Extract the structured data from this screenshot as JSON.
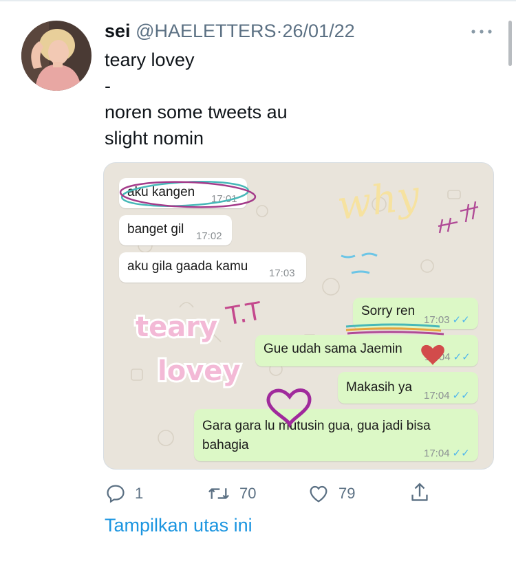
{
  "tweet": {
    "display_name": "sei",
    "handle": "@HAELETTERS",
    "separator": "·",
    "date": "26/01/22",
    "body": "teary lovey\n-\nnoren some tweets au\nslight nomin"
  },
  "chat": {
    "incoming": [
      {
        "text": "aku kangen",
        "time": "17:01"
      },
      {
        "text": "banget gil",
        "time": "17:02"
      },
      {
        "text": "aku gila gaada kamu",
        "time": "17:03"
      }
    ],
    "outgoing": [
      {
        "text": "Sorry ren",
        "time": "17:03"
      },
      {
        "text": "Gue udah sama Jaemin",
        "time": "17:04"
      },
      {
        "text": "Makasih ya",
        "time": "17:04"
      },
      {
        "text": "Gara gara lu mutusin gua, gua jadi bisa\nbahagia",
        "time": "17:04"
      }
    ],
    "stickers": {
      "teary": "teary",
      "lovey": "lovey",
      "tt": "T.T",
      "why": "why"
    }
  },
  "actions": {
    "reply_count": "1",
    "retweet_count": "70",
    "like_count": "79"
  },
  "thread_link": "Tampilkan utas ini",
  "colors": {
    "link": "#1b95e0",
    "secondary_text": "#5b7083",
    "chat_background": "#e9e4db",
    "outgoing_bubble": "#dcf8c6",
    "read_ticks": "#4fb6ec"
  }
}
